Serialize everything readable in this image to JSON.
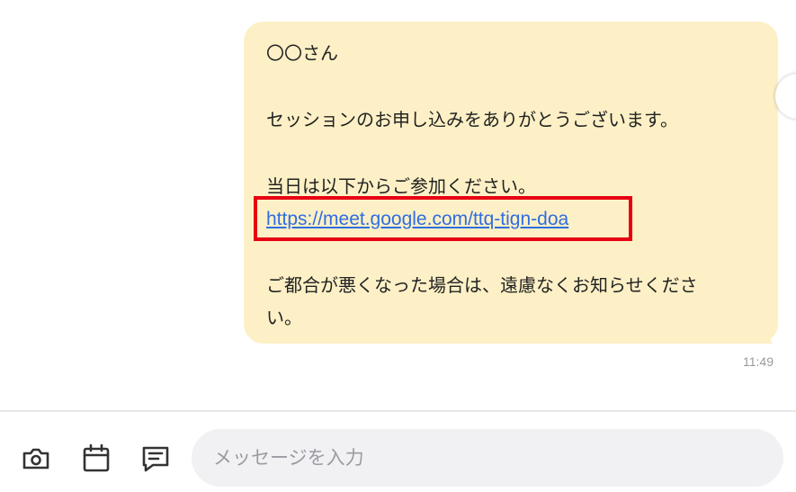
{
  "message": {
    "greeting": "〇〇さん",
    "thanks": "セッションのお申し込みをありがとうございます。",
    "join_text": "当日は以下からご参加ください。",
    "link": "https://meet.google.com/ttq-tign-doa",
    "notice_line1": "ご都合が悪くなった場合は、遠慮なくお知らせくださ",
    "notice_line2": "い。",
    "time": "11:49",
    "bubble_color": "#fdf0c6",
    "link_color": "#2f6de1",
    "highlight_color": "#e60012"
  },
  "composer": {
    "placeholder": "メッセージを入力",
    "icons": [
      "camera-icon",
      "calendar-icon",
      "message-template-icon"
    ]
  }
}
